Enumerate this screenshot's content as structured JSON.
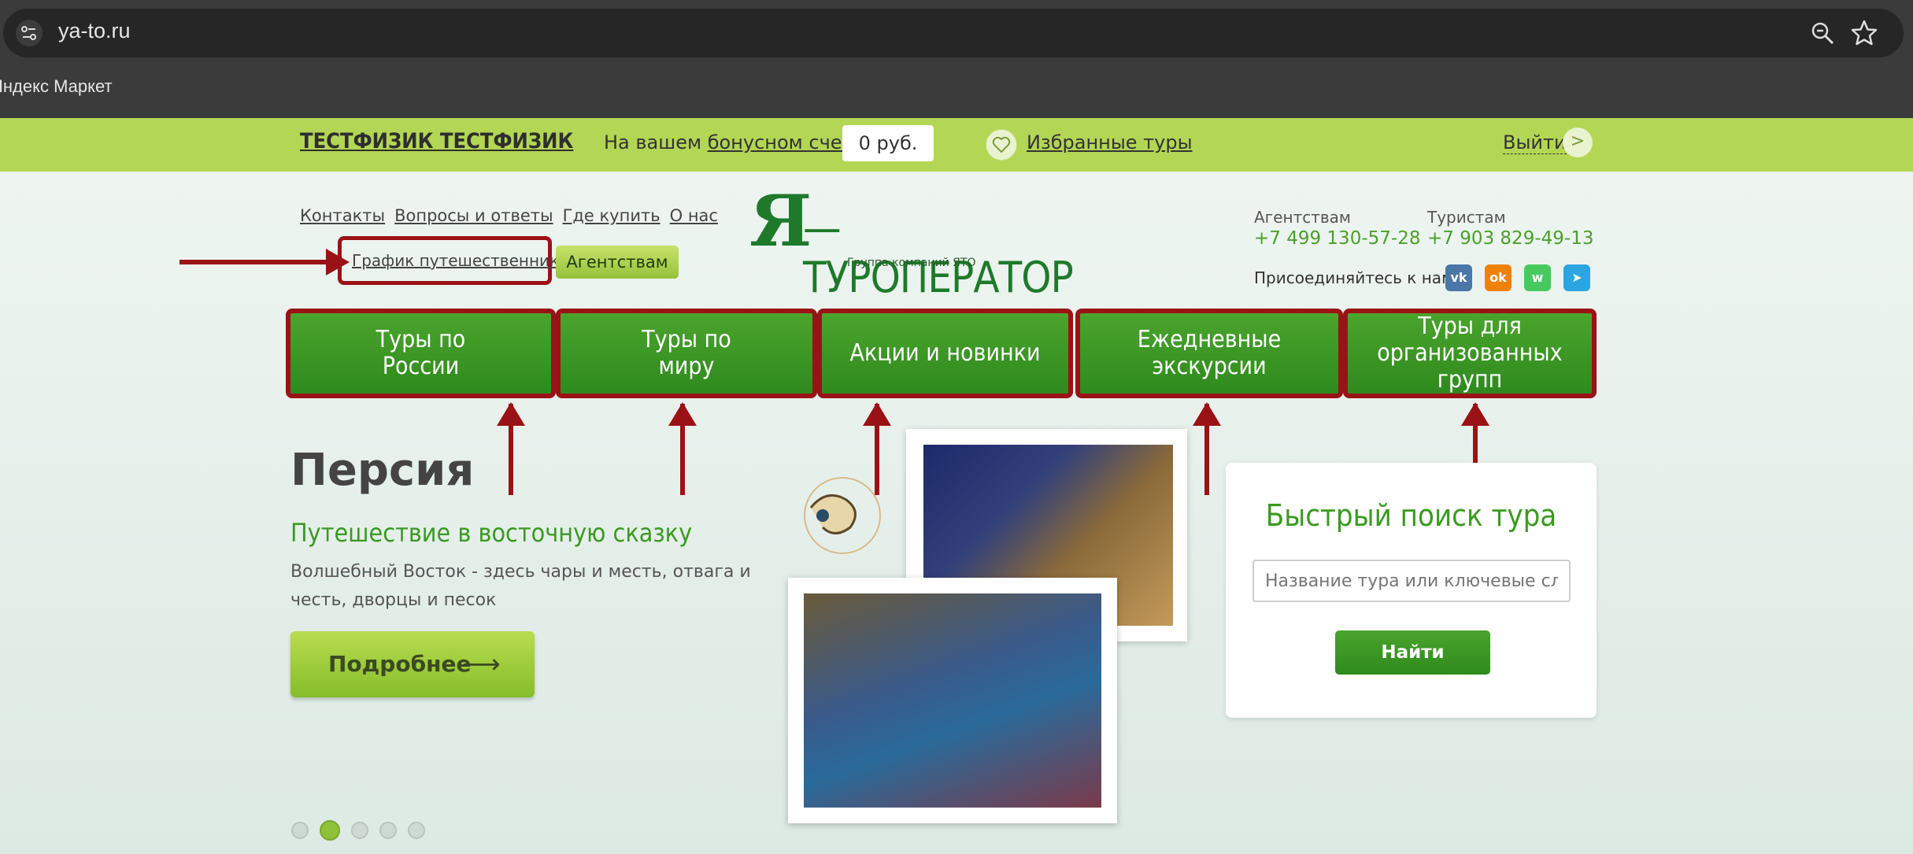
{
  "browser": {
    "url": "ya-to.ru",
    "bookmark": "Яндекс Маркет"
  },
  "topbar": {
    "user": "ТЕСТФИЗИК ТЕСТФИЗИК",
    "bonus_prefix": "На вашем",
    "bonus_link": "бонусном счету",
    "balance": "0 руб.",
    "favorites": "Избранные туры",
    "logout": "Выйти"
  },
  "header": {
    "links": [
      "Контакты",
      "Вопросы и ответы",
      "Где купить",
      "О нас"
    ],
    "traveler_schedule": "График путешественника",
    "agents_button": "Агентствам",
    "logo": {
      "ya": "Я",
      "name": "—ТУРОПЕРАТОР",
      "sub": "Группа компаний ЯТО"
    },
    "contacts": {
      "agents_label": "Агентствам",
      "agents_phone": "+7 499 130-57-28",
      "tourists_label": "Туристам",
      "tourists_phone": "+7 903 829-49-13",
      "join": "Присоединяйтесь к нам:"
    },
    "social": [
      {
        "name": "vk-icon",
        "label": "vk",
        "color": "#4a76a8"
      },
      {
        "name": "odnoklassniki-icon",
        "label": "ok",
        "color": "#ee8208"
      },
      {
        "name": "whatsapp-icon",
        "label": "w",
        "color": "#48c95f"
      },
      {
        "name": "telegram-icon",
        "label": "➤",
        "color": "#2ca5e0"
      }
    ]
  },
  "nav": [
    {
      "line1": "Туры по",
      "line2": "России"
    },
    {
      "line1": "Туры по",
      "line2": "миру"
    },
    {
      "line1": "Акции и новинки",
      "line2": ""
    },
    {
      "line1": "Ежедневные",
      "line2": "экскурсии"
    },
    {
      "line1": "Туры для",
      "line2": "организованных групп"
    }
  ],
  "hero": {
    "title": "Персия",
    "subtitle": "Путешествие в восточную сказку",
    "description": "Волшебный Восток - здесь чары и месть, отвага и честь, дворцы и песок",
    "button": "Подробнее",
    "button_arrow": "⟶"
  },
  "search": {
    "title": "Быстрый поиск тура",
    "placeholder": "Название тура или ключевые слова",
    "button": "Найти"
  },
  "slider": {
    "count": 5,
    "active": 2
  },
  "colors": {
    "accent": "#3a9a20",
    "annotation": "#9b1216",
    "topbar": "#b3d654"
  }
}
